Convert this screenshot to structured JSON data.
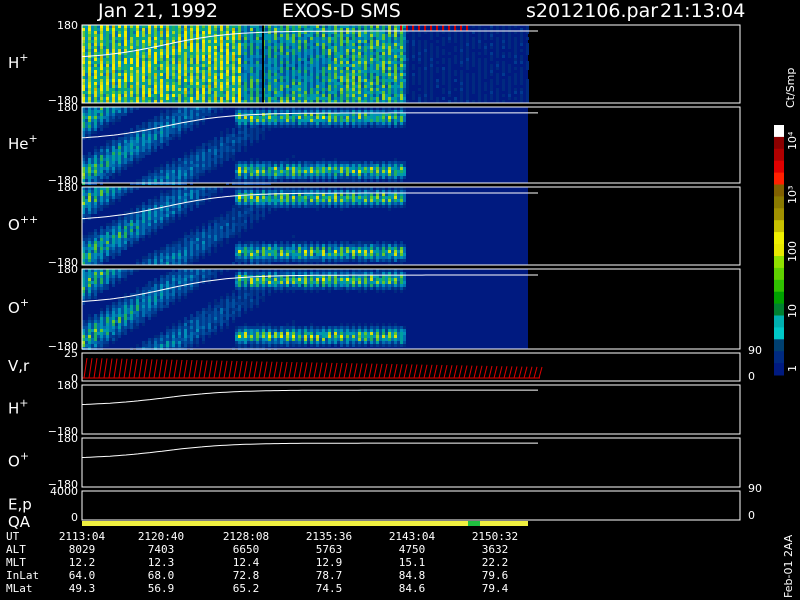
{
  "header": {
    "date": "Jan 21, 1992",
    "instrument": "EXOS-D SMS",
    "file": "s2012106.par",
    "time": "21:13:04"
  },
  "colorbar": {
    "unit": "Ct/Smp",
    "labels": [
      "10⁴",
      "10³",
      "100",
      "10",
      "1"
    ],
    "colors": [
      "#ffffff",
      "#8b0000",
      "#b00000",
      "#e00000",
      "#ff2000",
      "#806000",
      "#8a7a00",
      "#a09000",
      "#c8c000",
      "#f0f000",
      "#e8e800",
      "#90e000",
      "#60d000",
      "#30c000",
      "#00a000",
      "#008030",
      "#00b0b0",
      "#00c8c8",
      "#004070",
      "#002a80",
      "#001a80"
    ]
  },
  "footer_code": "Feb-01 2AA",
  "chart_data": {
    "type": "heatmap",
    "panels": [
      {
        "label": "H+",
        "ymax": "180",
        "ymin": "−180",
        "kind": "spectrogram"
      },
      {
        "label": "He+",
        "ymax": "180",
        "ymin": "−180",
        "kind": "spectrogram"
      },
      {
        "label": "O++",
        "ymax": "180",
        "ymin": "−180",
        "kind": "spectrogram"
      },
      {
        "label": "O+",
        "ymax": "180",
        "ymin": "−180",
        "kind": "spectrogram"
      },
      {
        "label": "V,r",
        "ymax": "25",
        "ymin": "0",
        "right_top": "90",
        "right_bottom": "0",
        "kind": "vector"
      },
      {
        "label": "H+",
        "ymax": "180",
        "ymin": "−180",
        "kind": "line"
      },
      {
        "label": "O+",
        "ymax": "180",
        "ymin": "−180",
        "kind": "line"
      },
      {
        "label": "E,p",
        "ymax": "4000",
        "ymin": "0",
        "right_top": "90",
        "right_bottom": "0",
        "kind": "empty"
      },
      {
        "label": "QA",
        "kind": "qa"
      }
    ],
    "x_axis": {
      "row_labels": [
        "UT",
        "ALT",
        "MLT",
        "InLat",
        "MLat"
      ],
      "columns": [
        {
          "UT": "2113:04",
          "ALT": "8029",
          "MLT": "12.2",
          "InLat": "64.0",
          "MLat": "49.3"
        },
        {
          "UT": "2120:40",
          "ALT": "7403",
          "MLT": "12.3",
          "InLat": "68.0",
          "MLat": "56.9"
        },
        {
          "UT": "2128:08",
          "ALT": "6650",
          "MLT": "12.4",
          "InLat": "72.8",
          "MLat": "65.2"
        },
        {
          "UT": "2135:36",
          "ALT": "5763",
          "MLT": "12.9",
          "InLat": "78.7",
          "MLat": "74.5"
        },
        {
          "UT": "2143:04",
          "ALT": "4750",
          "MLT": "15.1",
          "InLat": "84.8",
          "MLat": "84.6"
        },
        {
          "UT": "2150:32",
          "ALT": "3632",
          "MLT": "22.2",
          "InLat": "79.6",
          "MLat": "79.4"
        }
      ]
    }
  }
}
